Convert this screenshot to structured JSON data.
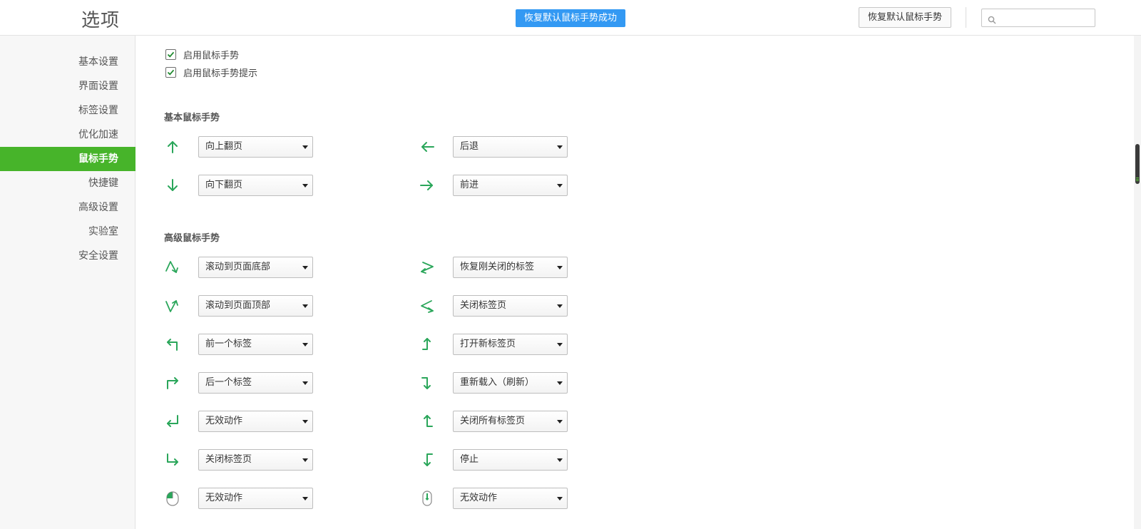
{
  "header": {
    "title": "选项",
    "toast": "恢复默认鼠标手势成功",
    "restore_button": "恢复默认鼠标手势",
    "search_placeholder": ""
  },
  "sidebar": {
    "items": [
      {
        "label": "基本设置"
      },
      {
        "label": "界面设置"
      },
      {
        "label": "标签设置"
      },
      {
        "label": "优化加速"
      },
      {
        "label": "鼠标手势",
        "active": true
      },
      {
        "label": "快捷键"
      },
      {
        "label": "高级设置"
      },
      {
        "label": "实验室"
      },
      {
        "label": "安全设置"
      }
    ]
  },
  "options": {
    "enable_gesture": {
      "label": "启用鼠标手势",
      "checked": true
    },
    "enable_gesture_hint": {
      "label": "启用鼠标手势提示",
      "checked": true
    }
  },
  "basic": {
    "title": "基本鼠标手势",
    "gestures": [
      {
        "icon": "arrow-up-icon",
        "value": "向上翻页"
      },
      {
        "icon": "arrow-left-icon",
        "value": "后退"
      },
      {
        "icon": "arrow-down-icon",
        "value": "向下翻页"
      },
      {
        "icon": "arrow-right-icon",
        "value": "前进"
      }
    ]
  },
  "advanced": {
    "title": "高级鼠标手势",
    "gestures": [
      {
        "icon": "up-down-gesture-icon",
        "value": "滚动到页面底部"
      },
      {
        "icon": "right-left-gesture-icon",
        "value": "恢复刚关闭的标签"
      },
      {
        "icon": "down-up-gesture-icon",
        "value": "滚动到页面顶部"
      },
      {
        "icon": "left-right-gesture-icon",
        "value": "关闭标签页"
      },
      {
        "icon": "up-left-gesture-icon",
        "value": "前一个标签"
      },
      {
        "icon": "left-up-gesture-icon",
        "value": "打开新标签页"
      },
      {
        "icon": "up-right-gesture-icon",
        "value": "后一个标签"
      },
      {
        "icon": "right-down-gesture-icon",
        "value": "重新载入（刷新）"
      },
      {
        "icon": "right-up-left-gesture-icon",
        "value": "无效动作"
      },
      {
        "icon": "down-left-up-gesture-icon",
        "value": "关闭所有标签页"
      },
      {
        "icon": "down-right-gesture-icon",
        "value": "关闭标签页"
      },
      {
        "icon": "right-down-left-gesture-icon",
        "value": "停止"
      },
      {
        "icon": "mouse-left-click-icon",
        "value": "无效动作"
      },
      {
        "icon": "mouse-wheel-icon",
        "value": "无效动作"
      }
    ]
  },
  "colors": {
    "accent": "#47b42a",
    "toast": "#3399f3",
    "gesture_icon": "#2aa65a"
  }
}
